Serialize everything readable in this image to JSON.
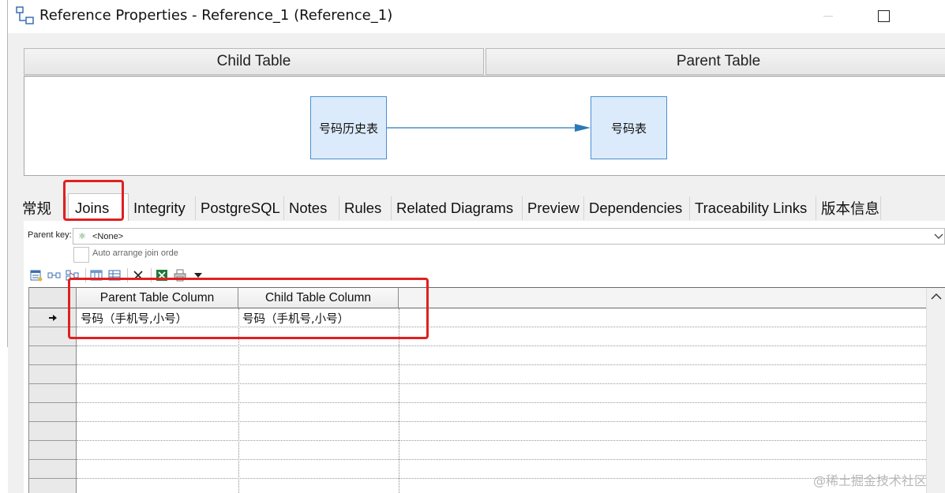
{
  "window": {
    "title": "Reference Properties - Reference_1 (Reference_1)"
  },
  "diagram": {
    "child_header": "Child Table",
    "parent_header": "Parent Table",
    "child_table": "号码历史表",
    "parent_table": "号码表"
  },
  "tabs": [
    {
      "label": "常规"
    },
    {
      "label": "Joins",
      "active": true
    },
    {
      "label": "Integrity"
    },
    {
      "label": "PostgreSQL"
    },
    {
      "label": "Notes"
    },
    {
      "label": "Rules"
    },
    {
      "label": "Related Diagrams"
    },
    {
      "label": "Preview"
    },
    {
      "label": "Dependencies"
    },
    {
      "label": "Traceability Links"
    },
    {
      "label": "版本信息"
    }
  ],
  "joins": {
    "parent_key_label": "Parent key:",
    "parent_key_value": "<None>",
    "auto_arrange_label": "Auto arrange join orde",
    "auto_arrange_checked": false,
    "toolbar_icons": [
      "properties-icon",
      "add-row-icon",
      "insert-row-icon",
      "add-columns-icon",
      "grid-icon",
      "delete-icon",
      "excel-export-icon",
      "print-icon",
      "dropdown-arrow-icon"
    ],
    "columns": [
      "Parent Table Column",
      "Child Table Column"
    ],
    "rows": [
      {
        "parent": "号码（手机号,小号）",
        "child": "号码（手机号,小号）",
        "current": true
      }
    ]
  },
  "watermark": "@稀土掘金技术社区",
  "colors": {
    "highlight": "#e02020",
    "table_fill": "#dcebfb",
    "table_border": "#4a8fd0",
    "link": "#2a7ab8"
  }
}
